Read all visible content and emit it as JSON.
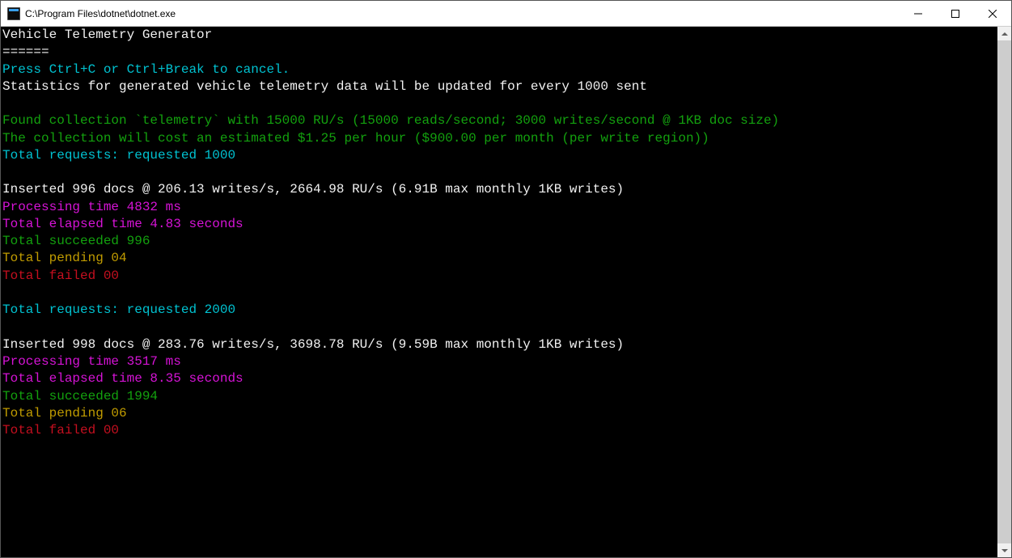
{
  "window": {
    "title": "C:\\Program Files\\dotnet\\dotnet.exe"
  },
  "console": {
    "header": {
      "title": "Vehicle Telemetry Generator",
      "divider": "======",
      "cancel_hint": "Press Ctrl+C or Ctrl+Break to cancel.",
      "stats_hint": "Statistics for generated vehicle telemetry data will be updated for every 1000 sent"
    },
    "collection": {
      "found_line": "Found collection `telemetry` with 15000 RU/s (15000 reads/second; 3000 writes/second @ 1KB doc size)",
      "cost_line": "The collection will cost an estimated $1.25 per hour ($900.00 per month (per write region))"
    },
    "batches": [
      {
        "requests_line": "Total requests: requested 1000",
        "inserted_line": "Inserted 996 docs @ 206.13 writes/s, 2664.98 RU/s (6.91B max monthly 1KB writes)",
        "processing_line": "Processing time 4832 ms",
        "elapsed_line": "Total elapsed time 4.83 seconds",
        "succeeded_line": "Total succeeded 996",
        "pending_line": "Total pending 04",
        "failed_line": "Total failed 00"
      },
      {
        "requests_line": "Total requests: requested 2000",
        "inserted_line": "Inserted 998 docs @ 283.76 writes/s, 3698.78 RU/s (9.59B max monthly 1KB writes)",
        "processing_line": "Processing time 3517 ms",
        "elapsed_line": "Total elapsed time 8.35 seconds",
        "succeeded_line": "Total succeeded 1994",
        "pending_line": "Total pending 06",
        "failed_line": "Total failed 00"
      }
    ]
  }
}
